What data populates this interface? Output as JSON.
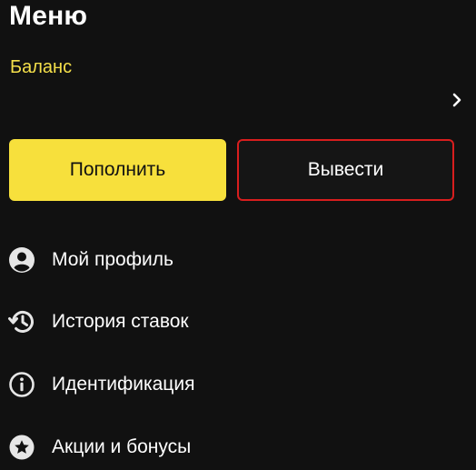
{
  "header": {
    "title": "Меню"
  },
  "balance": {
    "label": "Баланс",
    "chevron_icon": "chevron-right-icon"
  },
  "actions": {
    "deposit_label": "Пополнить",
    "withdraw_label": "Вывести"
  },
  "menu": {
    "items": [
      {
        "label": "Мой профиль",
        "icon": "user-circle-icon"
      },
      {
        "label": "История ставок",
        "icon": "history-icon"
      },
      {
        "label": "Идентификация",
        "icon": "info-icon"
      },
      {
        "label": "Акции и бонусы",
        "icon": "star-icon"
      }
    ]
  },
  "colors": {
    "background": "#111111",
    "accent_yellow": "#f7e03c",
    "balance_label": "#f5e04a",
    "highlight_border": "#d81e1e",
    "text": "#ffffff"
  }
}
